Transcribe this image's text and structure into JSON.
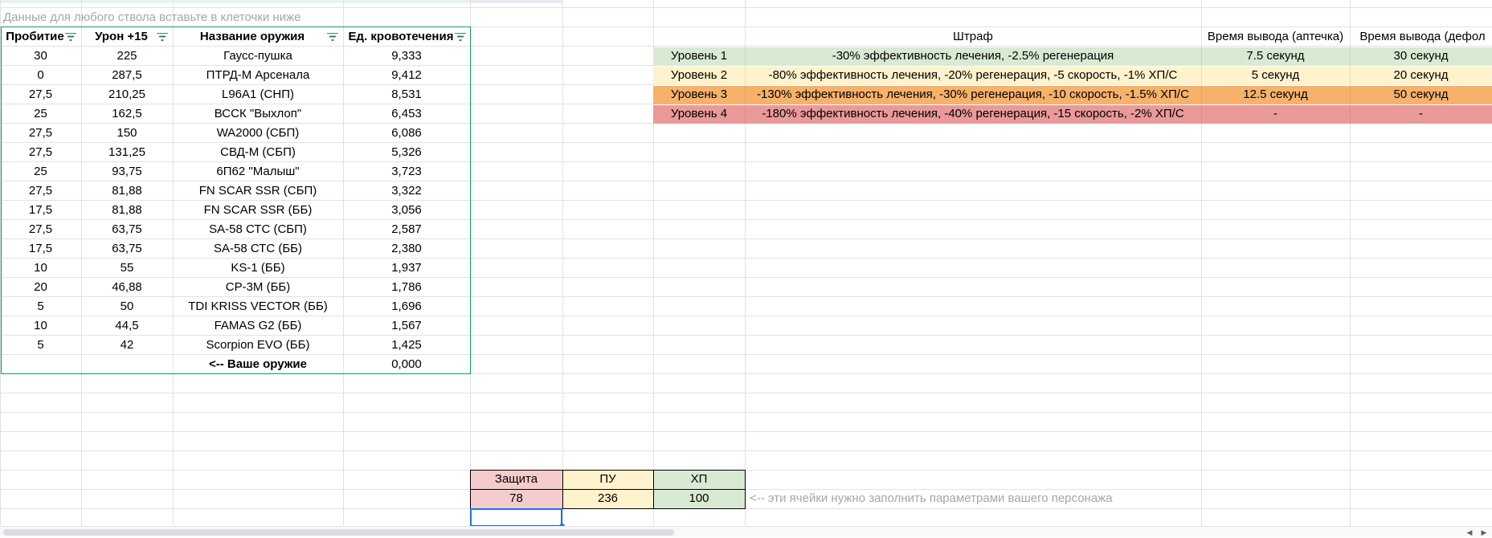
{
  "hint_top": "Данные для любого ствола вставьте  в клеточки ниже",
  "weapons_table": {
    "headers": [
      "Пробитие",
      "Урон +15",
      "Название оружия",
      "Ед. кровотечения"
    ],
    "rows": [
      [
        "30",
        "225",
        "Гаусс-пушка",
        "9,333"
      ],
      [
        "0",
        "287,5",
        "ПТРД-М Арсенала",
        "9,412"
      ],
      [
        "27,5",
        "210,25",
        "L96A1 (СНП)",
        "8,531"
      ],
      [
        "25",
        "162,5",
        "ВССК \"Выхлоп\"",
        "6,453"
      ],
      [
        "27,5",
        "150",
        "WA2000 (СБП)",
        "6,086"
      ],
      [
        "27,5",
        "131,25",
        "СВД-М (СБП)",
        "5,326"
      ],
      [
        "25",
        "93,75",
        "6П62 \"Малыш\"",
        "3,723"
      ],
      [
        "27,5",
        "81,88",
        "FN SCAR SSR (СБП)",
        "3,322"
      ],
      [
        "17,5",
        "81,88",
        "FN SCAR SSR (ББ)",
        "3,056"
      ],
      [
        "27,5",
        "63,75",
        "SA-58 СТС (СБП)",
        "2,587"
      ],
      [
        "17,5",
        "63,75",
        "SA-58 СТС (ББ)",
        "2,380"
      ],
      [
        "10",
        "55",
        "KS-1 (ББ)",
        "1,937"
      ],
      [
        "20",
        "46,88",
        "СР-3М (ББ)",
        "1,786"
      ],
      [
        "5",
        "50",
        "TDI KRISS VECTOR (ББ)",
        "1,696"
      ],
      [
        "10",
        "44,5",
        "FAMAS G2 (ББ)",
        "1,567"
      ],
      [
        "5",
        "42",
        "Scorpion EVO (ББ)",
        "1,425"
      ]
    ],
    "your_weapon": {
      "label": "<-- Ваше оружие",
      "value": "0,000"
    }
  },
  "penalty_table": {
    "headers": [
      "",
      "Штраф",
      "Время вывода (аптечка)",
      "Время вывода (дефол"
    ],
    "rows": [
      {
        "level": "Уровень 1",
        "penalty": "-30% эффективность лечения, -2.5% регенерация",
        "med": "7.5 секунд",
        "def": "30 секунд",
        "color": "#d9ead3"
      },
      {
        "level": "Уровень 2",
        "penalty": "-80% эффективность лечения, -20% регенерация, -5 скорость, -1% ХП/С",
        "med": "5 секунд",
        "def": "20 секунд",
        "color": "#fff2cc"
      },
      {
        "level": "Уровень 3",
        "penalty": "-130% эффективность лечения, -30% регенерация, -10 скорость, -1.5% ХП/С",
        "med": "12.5 секунд",
        "def": "50 секунд",
        "color": "#f6b26b"
      },
      {
        "level": "Уровень 4",
        "penalty": "-180% эффективность лечения, -40% регенерация, -15 скорость, -2% ХП/С",
        "med": "-",
        "def": "-",
        "color": "#ea9999"
      }
    ]
  },
  "params": {
    "headers": [
      "Защита",
      "ПУ",
      "ХП"
    ],
    "values": [
      "78",
      "236",
      "100"
    ],
    "colors": [
      "#f4cccc",
      "#fff2cc",
      "#d9ead3"
    ],
    "hint": "<-- эти ячейки нужно заполнить параметрами вашего персонажа"
  },
  "colors": {
    "grid_line": "#e2e2e2",
    "table_border": "#0f9d58",
    "filter_icon": "#188038",
    "selection": "#1a73e8"
  },
  "icons": {
    "filter": "filter-icon",
    "scroll_left": "chevron-left-icon",
    "scroll_right": "chevron-right-icon"
  }
}
